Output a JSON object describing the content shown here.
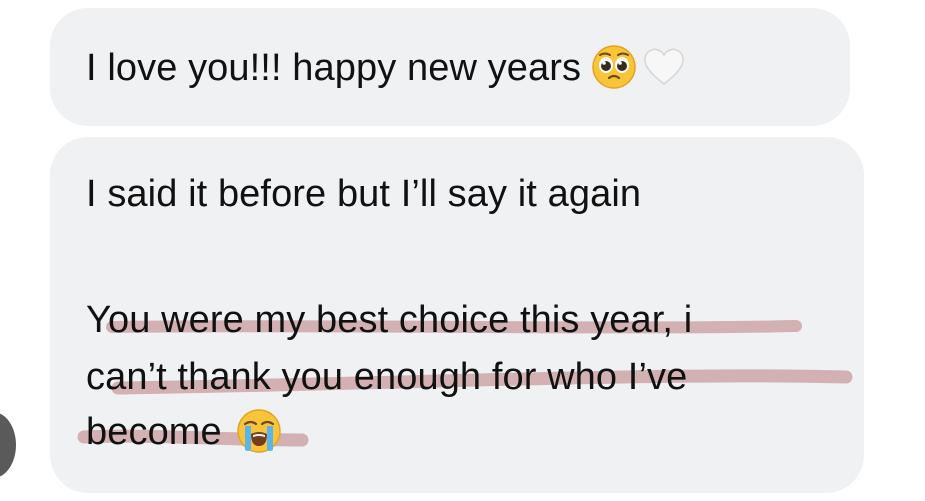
{
  "messages": [
    {
      "lines": [
        "I love you!!! happy new years"
      ],
      "emojis": [
        "pleading-face",
        "white-heart"
      ]
    },
    {
      "lines": [
        "I said it before but I’ll say it again",
        "You were my best choice this year, i",
        "can’t thank you enough for who I’ve",
        "become"
      ],
      "emojis": [
        "loudly-crying-face"
      ]
    }
  ],
  "colors": {
    "bubble": "#f0f1f3",
    "text": "#111111",
    "highlight": "#b06464"
  }
}
